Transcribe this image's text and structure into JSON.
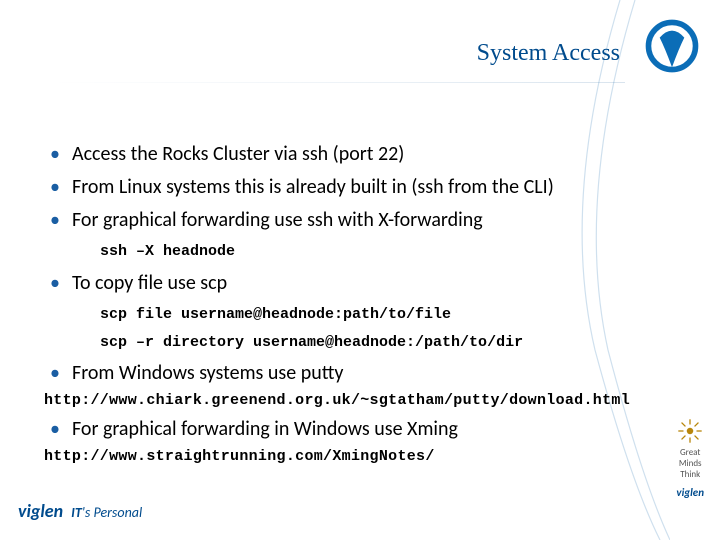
{
  "title": "System Access",
  "bullets": [
    {
      "text": "Access the Rocks Cluster via ssh (port 22)"
    },
    {
      "text": "From Linux systems this is already built in (ssh from the CLI)"
    },
    {
      "text": "For graphical forwarding use ssh with X-forwarding",
      "code": [
        "ssh –X headnode"
      ]
    },
    {
      "text": "To copy file use scp",
      "code": [
        "scp file username@headnode:path/to/file",
        "scp –r directory username@headnode:/path/to/dir"
      ]
    },
    {
      "text": "From Windows systems use putty",
      "url": "http://www.chiark.greenend.org.uk/~sgtatham/putty/download.html"
    },
    {
      "text": "For graphical forwarding in Windows use Xming",
      "url": "http://www.straightrunning.com/XmingNotes/"
    }
  ],
  "brand": {
    "footer_name": "viglen",
    "footer_tag_it": "IT",
    "footer_tag_rest": "'s Personal",
    "side_words": [
      "Great",
      "Minds",
      "Think"
    ],
    "side_logo": "viglen"
  }
}
